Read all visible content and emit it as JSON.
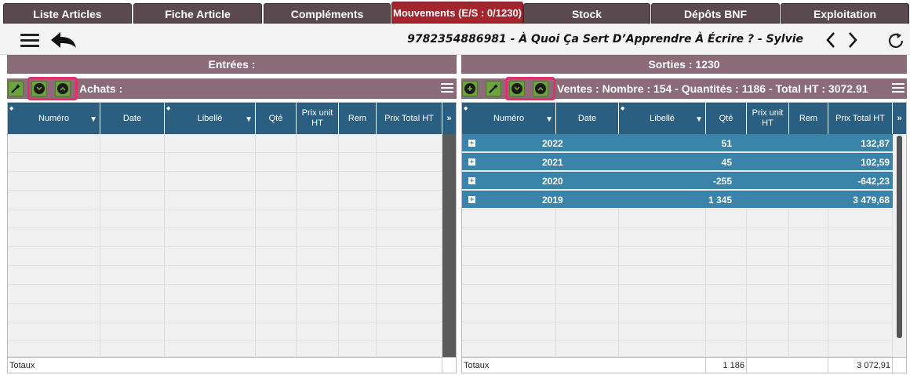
{
  "tabs": [
    {
      "label": "Liste Articles"
    },
    {
      "label": "Fiche Article"
    },
    {
      "label": "Compléments"
    },
    {
      "label": "Mouvements (E/S : 0/1230)"
    },
    {
      "label": "Stock"
    },
    {
      "label": "Dépôts BNF"
    },
    {
      "label": "Exploitation"
    }
  ],
  "header": {
    "title": "9782354886981 - À Quoi Ça Sert D’Apprendre À Écrire ? - Sylvie"
  },
  "left": {
    "panel_title": "Entrées :",
    "toolbar_title": "Achats :",
    "columns": [
      "Numéro",
      "Date",
      "Libellé",
      "Qté",
      "Prix unit HT",
      "Rem",
      "Prix Total HT"
    ],
    "totals_label": "Totaux"
  },
  "right": {
    "panel_title": "Sorties : 1230",
    "toolbar_title": "Ventes : Nombre : 154 - Quantités : 1186 - Total HT : 3072.91",
    "columns": [
      "Numéro",
      "Date",
      "Libellé",
      "Qté",
      "Prix unit HT",
      "Rem",
      "Prix Total HT"
    ],
    "rows": [
      {
        "year": "2022",
        "qty": "51",
        "total": "132,87"
      },
      {
        "year": "2021",
        "qty": "45",
        "total": "102,59"
      },
      {
        "year": "2020",
        "qty": "-255",
        "total": "-642,23"
      },
      {
        "year": "2019",
        "qty": "1 345",
        "total": "3 479,68"
      }
    ],
    "totals_label": "Totaux",
    "totals_qty": "1 186",
    "totals_total": "3 072,91"
  },
  "colors": {
    "tab_bg": "#5a4a50",
    "tab_active": "#a3252e",
    "panel": "#8c6b78",
    "grid_header": "#2a5f82",
    "year_row": "#3a84aa",
    "button": "#6da33e",
    "highlight": "#e0306a"
  }
}
